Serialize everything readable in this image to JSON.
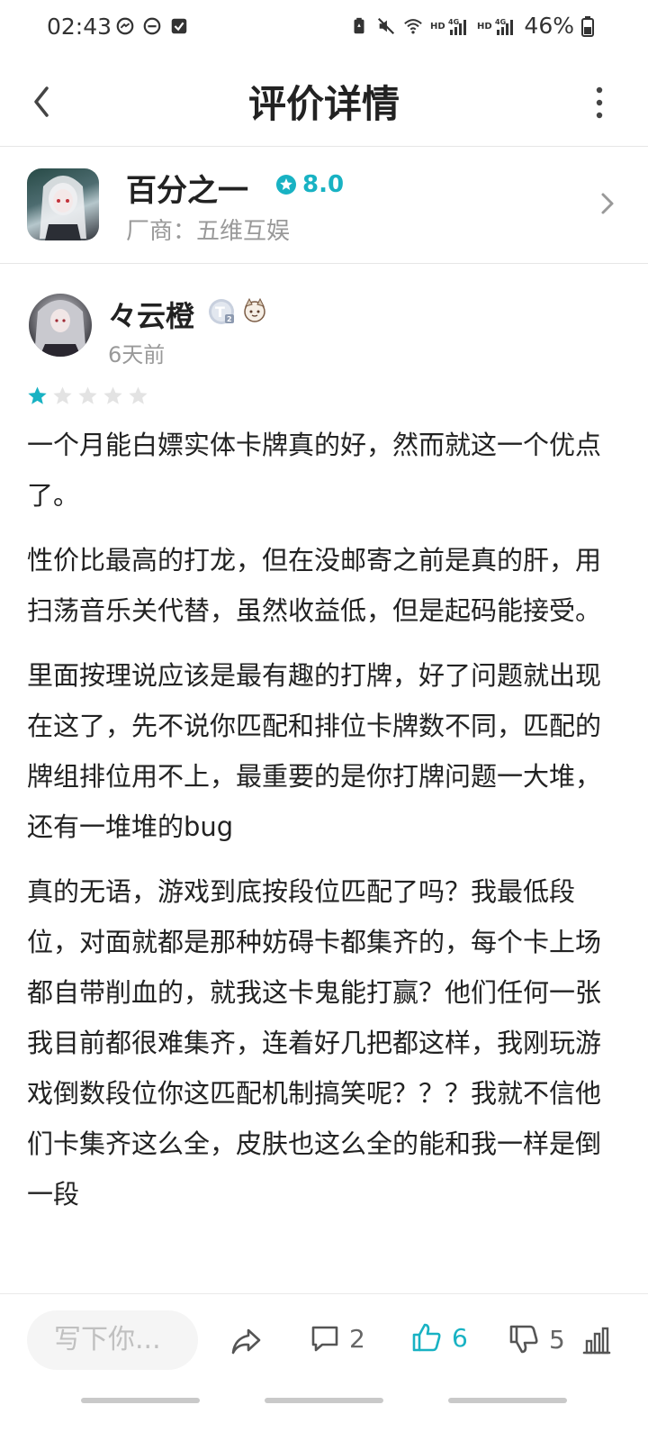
{
  "status_bar": {
    "time": "02:43",
    "battery": "46%",
    "icons": [
      "messenger-icon",
      "do-not-disturb-icon",
      "checkbox-notification-icon",
      "battery-saver-icon",
      "mute-icon",
      "wifi-icon",
      "hd-4g-signal-icon",
      "hd-4g-signal-icon",
      "battery-icon"
    ]
  },
  "header": {
    "title": "评价详情"
  },
  "app": {
    "name": "百分之一",
    "rating": "8.0",
    "vendor_label": "厂商：",
    "vendor_name": "五维互娱"
  },
  "review": {
    "username": "々云橙",
    "time_ago": "6天前",
    "stars": 1,
    "stars_max": 5,
    "paragraphs": [
      "一个月能白嫖实体卡牌真的好，然而就这一个优点了。",
      "性价比最高的打龙，但在没邮寄之前是真的肝，用扫荡音乐关代替，虽然收益低，但是起码能接受。",
      "里面按理说应该是最有趣的打牌，好了问题就出现在这了，先不说你匹配和排位卡牌数不同，匹配的牌组排位用不上，最重要的是你打牌问题一大堆，还有一堆堆的bug",
      "真的无语，游戏到底按段位匹配了吗？我最低段位，对面就都是那种妨碍卡都集齐的，每个卡上场都自带削血的，就我这卡鬼能打赢？他们任何一张我目前都很难集齐，连着好几把都这样，我刚玩游戏倒数段位你这匹配机制搞笑呢？？？我就不信他们卡集齐这么全，皮肤也这么全的能和我一样是倒一段"
    ]
  },
  "bottom_bar": {
    "input_placeholder": "写下你...",
    "comment_count": "2",
    "like_count": "6",
    "dislike_count": "5"
  },
  "colors": {
    "accent": "#18b2c3",
    "star_active": "#18b2c3",
    "star_inactive": "#e3e3e3",
    "text_primary": "#222222",
    "text_secondary": "#999999"
  }
}
